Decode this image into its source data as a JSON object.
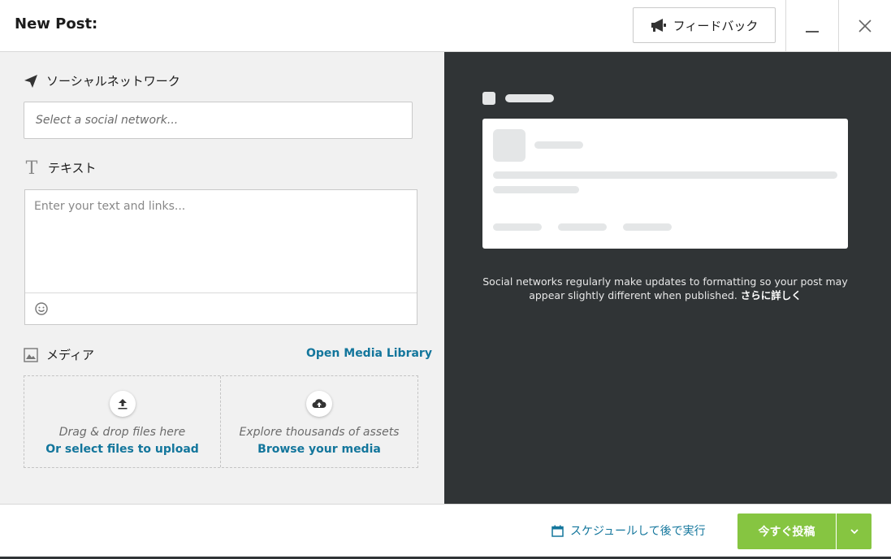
{
  "header": {
    "title": "New Post:",
    "feedback_label": "フィードバック",
    "feedback_icon": "megaphone-icon",
    "minimize_icon": "minimize-icon",
    "close_icon": "close-icon"
  },
  "compose": {
    "social_network": {
      "label": "ソーシャルネットワーク",
      "icon": "paper-plane-icon",
      "placeholder": "Select a social network..."
    },
    "text": {
      "label": "テキスト",
      "icon": "text-t-icon",
      "placeholder": "Enter your text and links...",
      "emoji_icon": "smiley-icon"
    },
    "media": {
      "label": "メディア",
      "icon": "image-icon",
      "open_library_label": "Open Media Library",
      "upload": {
        "icon": "upload-icon",
        "description": "Drag & drop files here",
        "link": "Or select files to upload"
      },
      "browse": {
        "icon": "cloud-upload-icon",
        "description": "Explore thousands of assets",
        "link": "Browse your media"
      }
    }
  },
  "preview": {
    "disclaimer": "Social networks regularly make updates to formatting so your post may appear slightly different when published.",
    "learn_more": "さらに詳しく"
  },
  "footer": {
    "schedule_label": "スケジュールして後で実行",
    "schedule_icon": "calendar-icon",
    "post_now_label": "今すぐ投稿",
    "post_options_icon": "chevron-down-icon"
  },
  "colors": {
    "accent_link": "#13769c",
    "post_button": "#86c541",
    "preview_background": "#303436",
    "compose_background": "#f1f1f1"
  }
}
